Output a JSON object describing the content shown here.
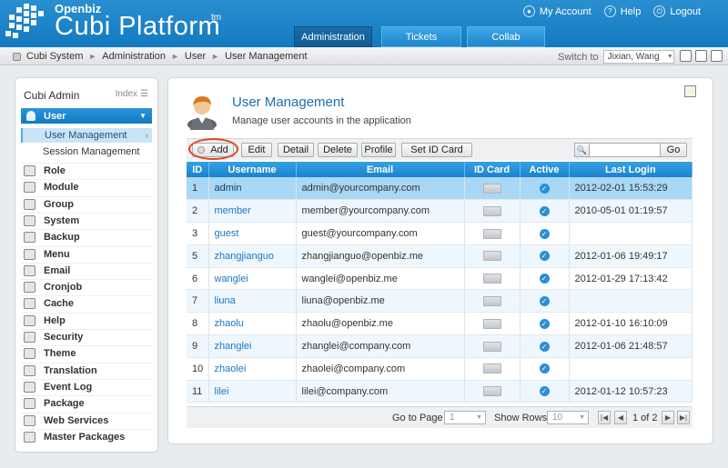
{
  "brand": {
    "small": "Openbiz",
    "big": "Cubi Platform",
    "tm": "tm"
  },
  "top_links": [
    "My Account",
    "Help",
    "Logout"
  ],
  "tabs": [
    "Administration",
    "Tickets",
    "Collab"
  ],
  "breadcrumb": [
    "Cubi System",
    "Administration",
    "User",
    "User Management"
  ],
  "switch_to": {
    "label": "Switch to",
    "value": "Jixian, Wang"
  },
  "sidebar": {
    "title": "Cubi Admin",
    "index_label": "Index",
    "section": "User",
    "sub_items": [
      "User Management",
      "Session Management"
    ],
    "items": [
      "Role",
      "Module",
      "Group",
      "System",
      "Backup",
      "Menu",
      "Email",
      "Cronjob",
      "Cache",
      "Help",
      "Security",
      "Theme",
      "Translation",
      "Event Log",
      "Package",
      "Web Services",
      "Master Packages"
    ]
  },
  "main": {
    "title": "User Management",
    "description": "Manage user accounts in the application",
    "buttons": [
      "Add",
      "Edit",
      "Detail",
      "Delete",
      "Profile",
      "Set ID Card"
    ],
    "search_button": "Go",
    "columns": [
      "ID",
      "Username",
      "Email",
      "ID Card",
      "Active",
      "Last Login"
    ],
    "rows": [
      {
        "id": "1",
        "username": "admin",
        "email": "admin@yourcompany.com",
        "last_login": "2012-02-01 15:53:29"
      },
      {
        "id": "2",
        "username": "member",
        "email": "member@yourcompany.com",
        "last_login": "2010-05-01 01:19:57"
      },
      {
        "id": "3",
        "username": "guest",
        "email": "guest@yourcompany.com",
        "last_login": ""
      },
      {
        "id": "5",
        "username": "zhangjianguo",
        "email": "zhangjianguo@openbiz.me",
        "last_login": "2012-01-06 19:49:17"
      },
      {
        "id": "6",
        "username": "wanglei",
        "email": "wanglei@openbiz.me",
        "last_login": "2012-01-29 17:13:42"
      },
      {
        "id": "7",
        "username": "liuna",
        "email": "liuna@openbiz.me",
        "last_login": ""
      },
      {
        "id": "8",
        "username": "zhaolu",
        "email": "zhaolu@openbiz.me",
        "last_login": "2012-01-10 16:10:09"
      },
      {
        "id": "9",
        "username": "zhanglei",
        "email": "zhanglei@company.com",
        "last_login": "2012-01-06 21:48:57"
      },
      {
        "id": "10",
        "username": "zhaolei",
        "email": "zhaolei@company.com",
        "last_login": ""
      },
      {
        "id": "11",
        "username": "lilei",
        "email": "lilei@company.com",
        "last_login": "2012-01-12 10:57:23"
      }
    ],
    "pager": {
      "goto_label": "Go to Page",
      "goto_value": "1",
      "rows_label": "Show Rows",
      "rows_value": "10",
      "page_info": "1 of 2"
    }
  },
  "colors": {
    "header": "#1b82c8",
    "accent": "#1c6fb0",
    "highlight": "#e0461e"
  }
}
